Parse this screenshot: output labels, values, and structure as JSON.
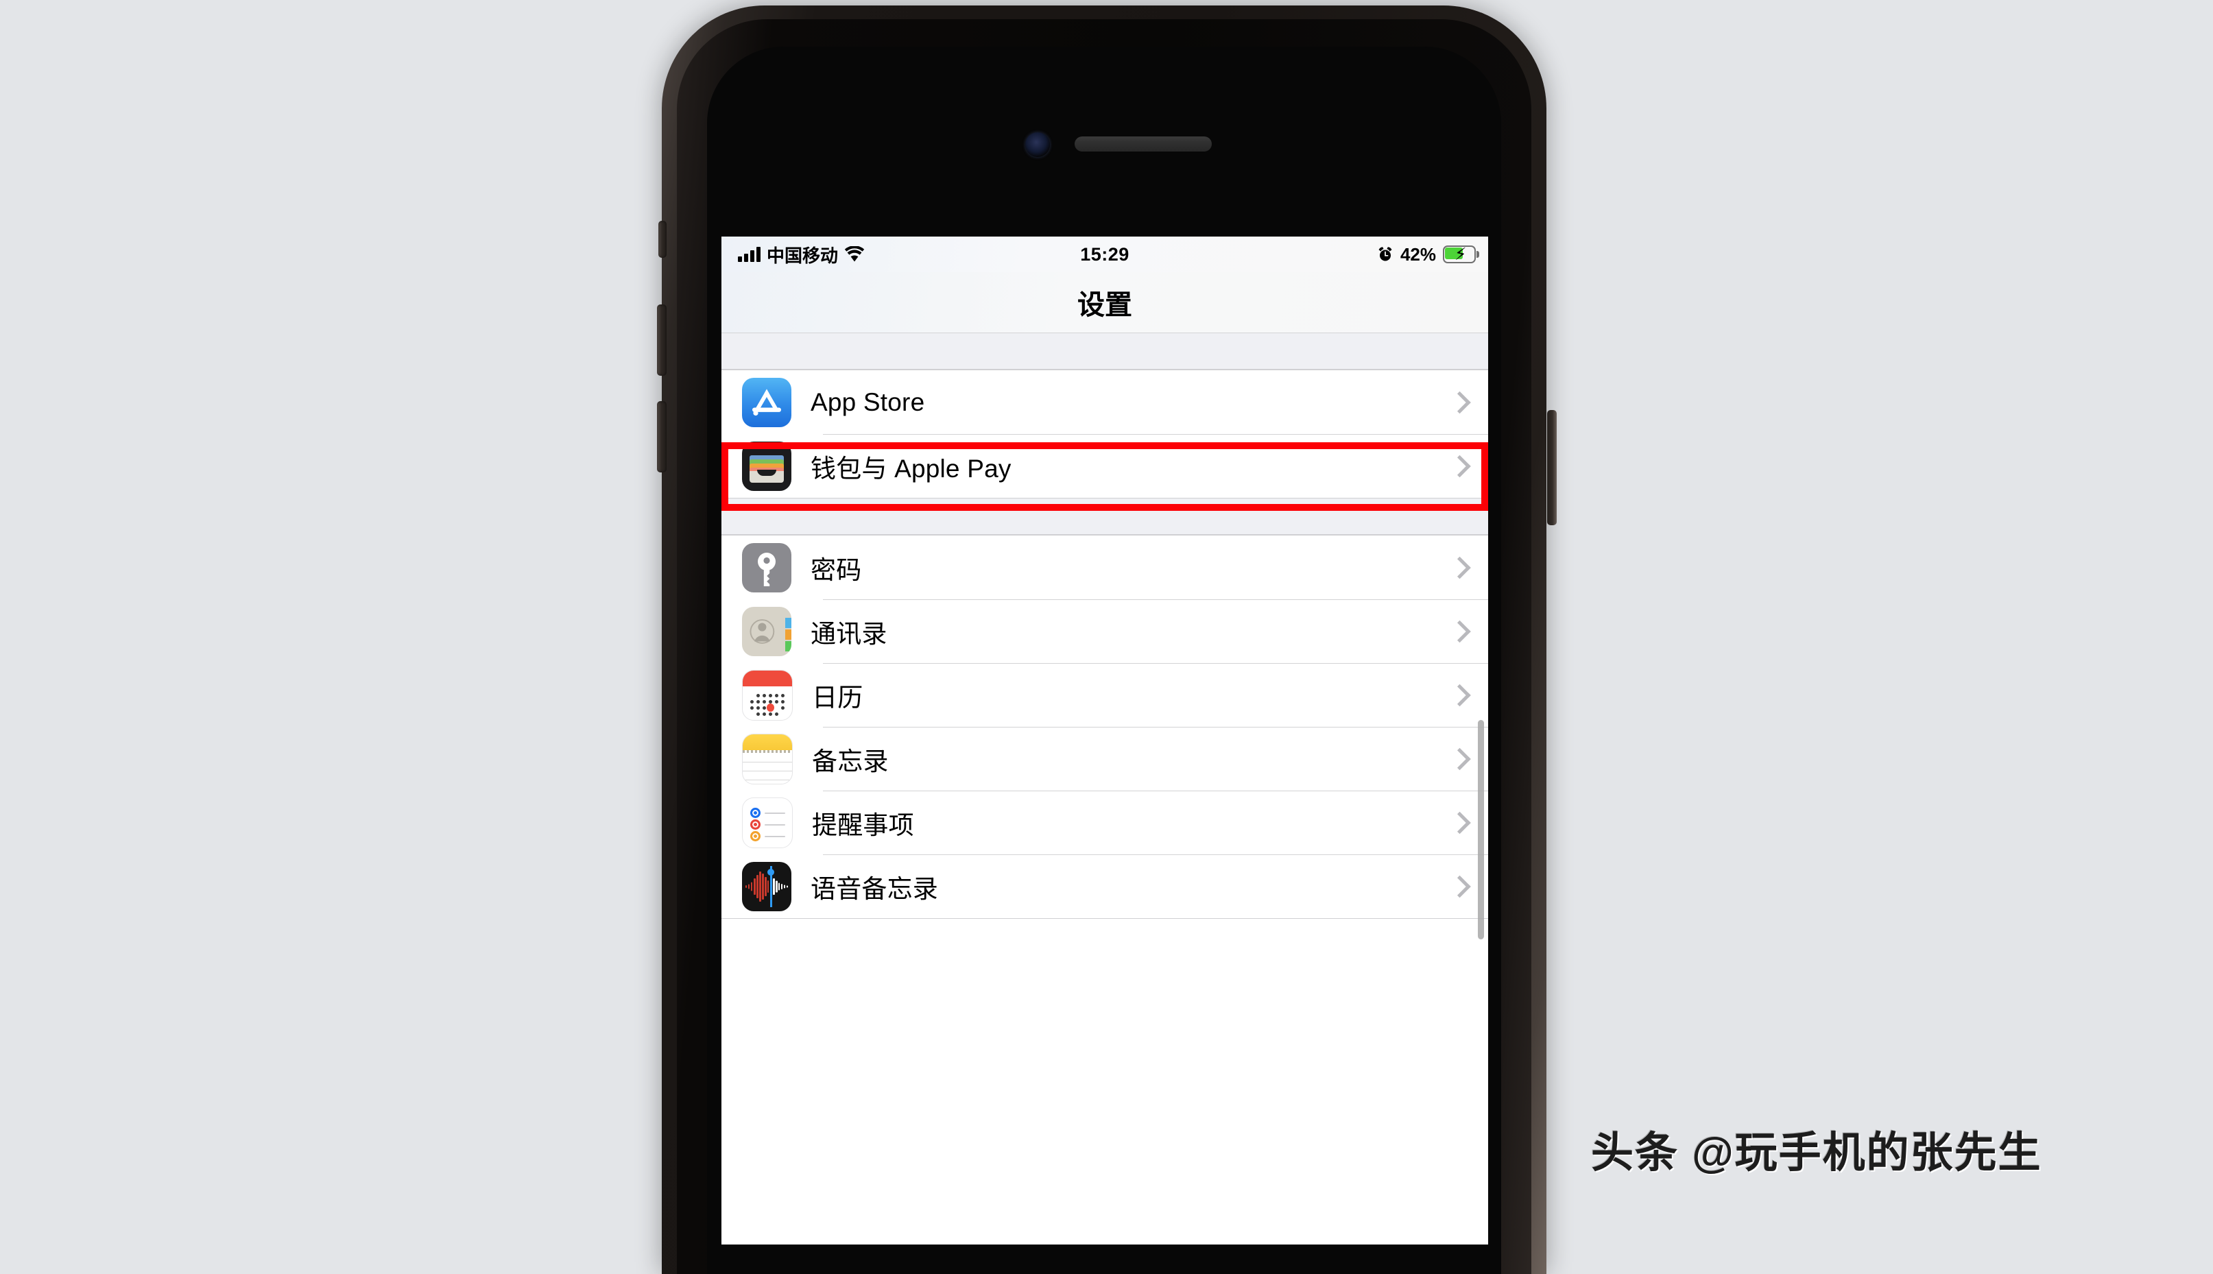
{
  "device": {
    "name": "iPhone",
    "camera_icon": "front-camera-icon",
    "speaker_icon": "earpiece-speaker-icon",
    "buttons": {
      "mute": "mute-switch",
      "volume_up": "volume-up-button",
      "volume_down": "volume-down-button",
      "power": "power-button"
    }
  },
  "status_bar": {
    "signal_icon": "signal-bars-icon",
    "carrier": "中国移动",
    "wifi_icon": "wifi-icon",
    "time": "15:29",
    "alarm_icon": "alarm-clock-icon",
    "battery_percent": "42%",
    "battery_icon": "battery-charging-icon",
    "battery_level": 42,
    "charging": true
  },
  "nav": {
    "title": "设置"
  },
  "highlight": {
    "color": "#fc0006",
    "target_row": "App Store"
  },
  "groups": [
    {
      "id": "group-store",
      "rows": [
        {
          "label": "App Store",
          "icon": "app-store-icon",
          "chevron": "chevron-right-icon",
          "highlighted": true
        },
        {
          "label": "钱包与 Apple Pay",
          "icon": "wallet-icon",
          "chevron": "chevron-right-icon",
          "highlighted": false
        }
      ]
    },
    {
      "id": "group-apps",
      "rows": [
        {
          "label": "密码",
          "icon": "passwords-key-icon",
          "chevron": "chevron-right-icon",
          "highlighted": false
        },
        {
          "label": "通讯录",
          "icon": "contacts-icon",
          "chevron": "chevron-right-icon",
          "highlighted": false
        },
        {
          "label": "日历",
          "icon": "calendar-icon",
          "chevron": "chevron-right-icon",
          "highlighted": false
        },
        {
          "label": "备忘录",
          "icon": "notes-icon",
          "chevron": "chevron-right-icon",
          "highlighted": false
        },
        {
          "label": "提醒事项",
          "icon": "reminders-icon",
          "chevron": "chevron-right-icon",
          "highlighted": false
        },
        {
          "label": "语音备忘录",
          "icon": "voice-memos-icon",
          "chevron": "chevron-right-icon",
          "highlighted": false
        }
      ]
    }
  ],
  "scrollbar": {
    "visible": true
  },
  "watermark": {
    "text": "头条 @玩手机的张先生"
  },
  "colors": {
    "page_background": "#e3e5e8",
    "list_background": "#ffffff",
    "group_gap": "#eff0f4",
    "separator": "#d3d3d5",
    "chevron": "#b9b9bd",
    "highlight": "#fc0006",
    "battery_green": "#4cd437"
  }
}
